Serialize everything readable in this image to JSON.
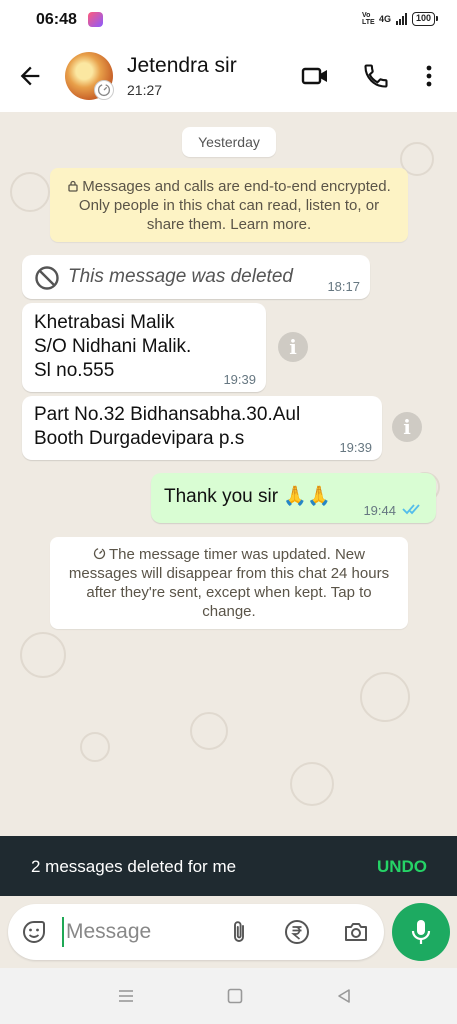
{
  "status_bar": {
    "time": "06:48",
    "network": "4G",
    "volte": "Vo LTE",
    "battery": "100"
  },
  "header": {
    "contact_name": "Jetendra sir",
    "last_seen": "21:27",
    "icons": [
      "back-arrow-icon",
      "video-call-icon",
      "phone-call-icon",
      "more-vert-icon"
    ]
  },
  "chat": {
    "date_chip": "Yesterday",
    "encryption_notice": "Messages and calls are end-to-end encrypted. Only people in this chat can read, listen to, or share them. Learn more.",
    "messages": [
      {
        "direction": "in",
        "deleted": true,
        "text": "This message was deleted",
        "time": "18:17"
      },
      {
        "direction": "in",
        "text": "Khetrabasi Malik\nS/O Nidhani Malik.\nSl no.555",
        "time": "19:39"
      },
      {
        "direction": "in",
        "text": "Part No.32 Bidhansabha.30.Aul\nBooth Durgadevipara  p.s",
        "time": "19:39"
      },
      {
        "direction": "out",
        "text": "Thank you sir 🙏🙏",
        "time": "19:44",
        "status": "read"
      }
    ],
    "timer_notice": "The message timer was updated. New messages will disappear from this chat 24 hours after they're sent, except when kept. Tap to change."
  },
  "snackbar": {
    "text": "2 messages deleted for me",
    "action": "UNDO"
  },
  "composer": {
    "placeholder": "Message"
  },
  "colors": {
    "chat_background": "#efeae2",
    "outgoing_bubble": "#d9fdd3",
    "accent_green": "#1daa61",
    "read_tick": "#53bdeb",
    "snackbar": "#1f2a30"
  }
}
